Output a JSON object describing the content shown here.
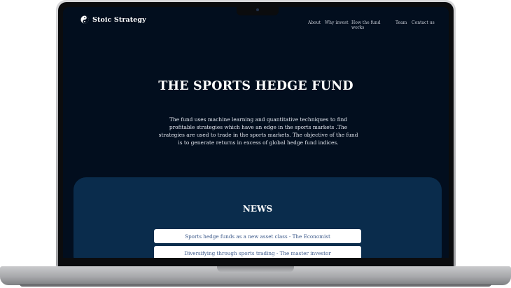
{
  "site": {
    "logo_text": "Stoic Strategy"
  },
  "nav": {
    "about": "About",
    "why_invest": "Why invest",
    "how_line1": "How the fund",
    "how_line2": "works",
    "team": "Team",
    "contact": "Contact us"
  },
  "hero": {
    "title": "THE SPORTS HEDGE FUND",
    "description": "The fund uses machine learning and quantitative techniques to find profitable strategies which have an edge in the sports markets .The strategies are used to trade in the sports markets. The objective of the fund is to generate returns in excess of global hedge fund indices."
  },
  "news": {
    "title": "NEWS",
    "items": [
      "Sports  hedge funds as a new asset class - The Economist",
      "Diversifying through sports trading - The master investor"
    ]
  },
  "colors": {
    "page_bg": "#020e1e",
    "news_panel": "#0a2c4c",
    "news_link": "#3d5a8a"
  }
}
